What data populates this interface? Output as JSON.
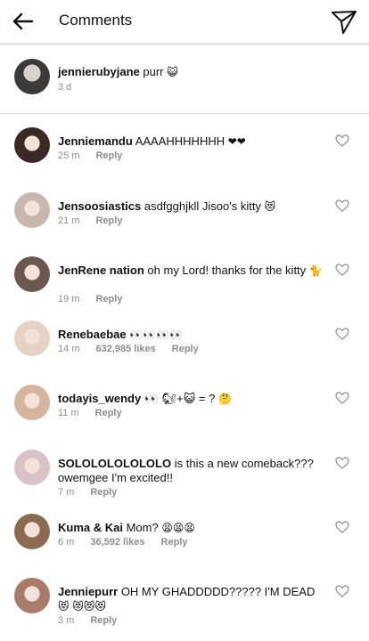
{
  "header": {
    "title": "Comments",
    "back_icon": "arrow-left-icon",
    "send_icon": "paper-plane-icon"
  },
  "caption": {
    "username": "jennierubyjane",
    "text": "purr",
    "emoji": "😺",
    "time": "3 d"
  },
  "comments": [
    {
      "username": "Jenniemandu",
      "text": "AAAAHHHHHHH",
      "emoji": "❤❤",
      "time": "25 m",
      "likes": "",
      "reply": "Reply",
      "avatar_color": "#3a2a26"
    },
    {
      "username": "Jensoosiastics",
      "text": "asdfgghjkll Jisoo's kitty",
      "emoji": "😻",
      "time": "21 m",
      "likes": "",
      "reply": "Reply",
      "avatar_color": "#c8b7ae"
    },
    {
      "username": "JenRene nation",
      "text": "oh my Lord! thanks for the kitty",
      "emoji": "🐈",
      "time": "19 m",
      "likes": "",
      "reply": "Reply",
      "avatar_color": "#6b5650"
    },
    {
      "username": "Renebaebae",
      "text": "",
      "emoji": "👀👀👀👀",
      "time": "14 m",
      "likes": "632,985 likes",
      "reply": "Reply",
      "avatar_color": "#e7d2c6"
    },
    {
      "username": "todayis_wendy",
      "text": "👀 🐿+😺 = ?",
      "emoji": "🤔",
      "time": "11 m",
      "likes": "",
      "reply": "Reply",
      "avatar_color": "#d6b59f"
    },
    {
      "username": "SOLOLOLOLOLOLO",
      "text": "is this a new comeback??? owemgee I'm excited!!",
      "emoji": "",
      "time": "7 m",
      "likes": "",
      "reply": "Reply",
      "avatar_color": "#d9c3c6"
    },
    {
      "username": "Kuma & Kai",
      "text": "Mom?",
      "emoji": "😫😫😫",
      "time": "6 m",
      "likes": "36,592 likes",
      "reply": "Reply",
      "avatar_color": "#8a6b4f"
    },
    {
      "username": "Jenniepurr",
      "text": "OH MY GHADDDDD????? I'M DEAD",
      "emoji": "😻 😻😻😻",
      "time": "3 m",
      "likes": "",
      "reply": "Reply",
      "avatar_color": "#a97b6a"
    }
  ]
}
